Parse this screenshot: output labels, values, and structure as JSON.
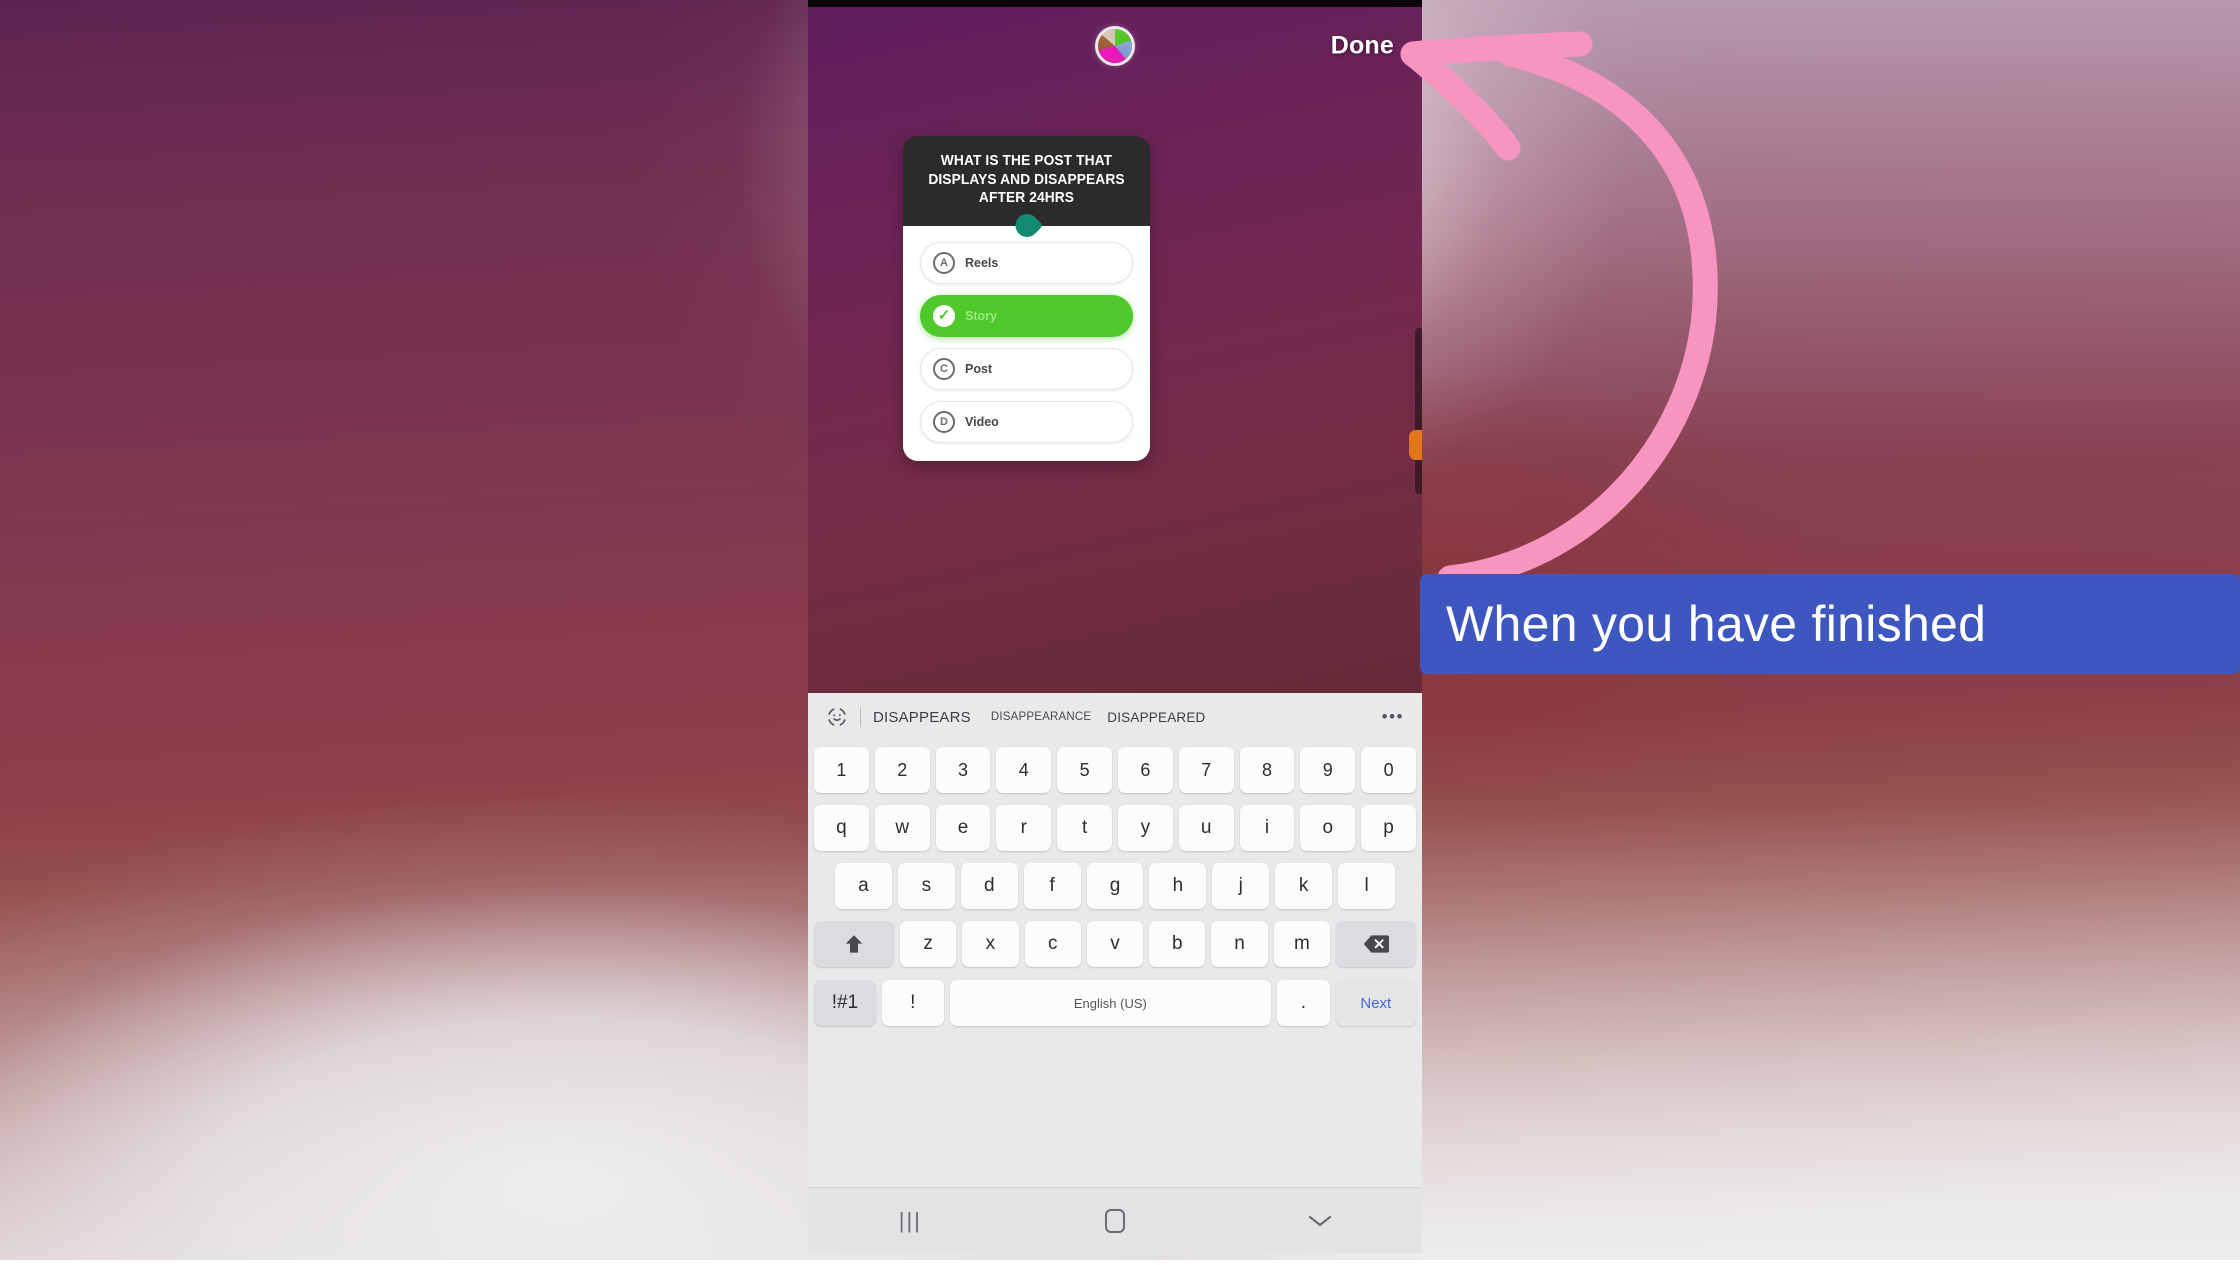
{
  "backdrop": {
    "accent_purple": "#6b2357",
    "accent_maroon": "#8a3c4c"
  },
  "phone": {
    "story_editor": {
      "color_wheel_icon": "color-wheel-icon",
      "done_label": "Done",
      "palette_swatch_color": "#e2761b"
    },
    "quiz_sticker": {
      "question": "WHAT IS THE POST THAT DISPLAYS AND DISAPPEARS AFTER 24HRS",
      "pointer_color": "#128b72",
      "selected_color": "#4ec82b",
      "answers": [
        {
          "badge": "A",
          "label": "Reels",
          "selected": false
        },
        {
          "badge": "✓",
          "label": "Story",
          "selected": true
        },
        {
          "badge": "C",
          "label": "Post",
          "selected": false
        },
        {
          "badge": "D",
          "label": "Video",
          "selected": false
        }
      ]
    },
    "keyboard": {
      "suggestions": [
        "DISAPPEARS",
        "DISAPPEARANCE",
        "DISAPPEARED"
      ],
      "more_label": "•••",
      "emoji_icon": "emoji-sticker-icon",
      "row_numbers": [
        "1",
        "2",
        "3",
        "4",
        "5",
        "6",
        "7",
        "8",
        "9",
        "0"
      ],
      "row_qwerty": [
        "q",
        "w",
        "e",
        "r",
        "t",
        "y",
        "u",
        "i",
        "o",
        "p"
      ],
      "row_asdf": [
        "a",
        "s",
        "d",
        "f",
        "g",
        "h",
        "j",
        "k",
        "l"
      ],
      "row_zxcv": [
        "z",
        "x",
        "c",
        "v",
        "b",
        "n",
        "m"
      ],
      "shift_icon": "shift-arrow-icon",
      "backspace_icon": "backspace-icon",
      "symbols_label": "!#1",
      "exclaim_label": "!",
      "space_label": "English (US)",
      "period_label": ".",
      "next_label": "Next",
      "next_color": "#4666d8"
    },
    "nav_bar": {
      "recents_icon": "recents-icon",
      "recents_glyph": "|||",
      "home_icon": "home-icon",
      "hide_keyboard_icon": "chevron-down-icon",
      "hide_keyboard_glyph": "⌄"
    }
  },
  "annotations": {
    "arrow_color": "#f894c0",
    "arrow_name": "pink-curved-arrow",
    "caption": "When you have finished",
    "caption_bg": "#3e56bf"
  }
}
